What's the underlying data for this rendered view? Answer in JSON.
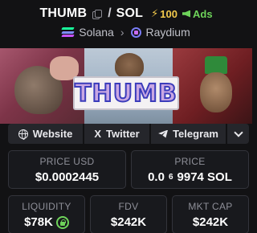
{
  "token": {
    "symbol": "THUMB",
    "separator": "/",
    "quote": "SOL",
    "boost_count": "100",
    "ads_label": "Ads"
  },
  "chain": {
    "name": "Solana",
    "dex": "Raydium"
  },
  "banner": {
    "logo_text": "THUMB"
  },
  "links": {
    "website": "Website",
    "twitter": "Twitter",
    "telegram": "Telegram",
    "x_glyph": "X"
  },
  "stats": {
    "price_usd": {
      "label": "PRICE USD",
      "value": "$0.0002445"
    },
    "price_native": {
      "label": "PRICE",
      "value_prefix": "0.0",
      "subscript": "6",
      "value_suffix": "9974 SOL"
    },
    "liquidity": {
      "label": "LIQUIDITY",
      "value": "$78K"
    },
    "fdv": {
      "label": "FDV",
      "value": "$242K"
    },
    "mkt_cap": {
      "label": "MKT CAP",
      "value": "$242K"
    }
  },
  "colors": {
    "background": "#121214",
    "card": "#18191d",
    "boost": "#f2c94c",
    "ads": "#6ed35a",
    "accent_purple": "#7a7cf6"
  }
}
